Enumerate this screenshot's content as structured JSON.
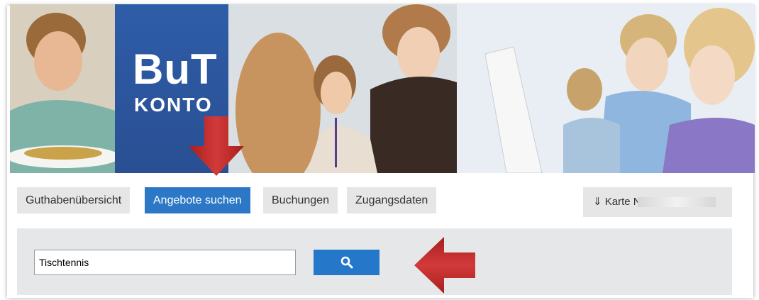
{
  "header": {
    "logo_title": "BuT",
    "logo_subtitle": "KONTO"
  },
  "nav": {
    "items": [
      {
        "label": "Guthabenübersicht",
        "active": false
      },
      {
        "label": "Angebote suchen",
        "active": true
      },
      {
        "label": "Buchungen",
        "active": false
      },
      {
        "label": "Zugangsdaten",
        "active": false
      }
    ],
    "card": {
      "icon": "download-arrow-icon",
      "label": "⇓ Karte Nr. 1("
    }
  },
  "search": {
    "value": "Tischtennis",
    "button_icon": "search-icon"
  },
  "colors": {
    "accent": "#2d78c6",
    "logo_blue": "#2a559c",
    "annotation_red": "#cc2a2a",
    "panel_gray": "#e6e7e8"
  }
}
